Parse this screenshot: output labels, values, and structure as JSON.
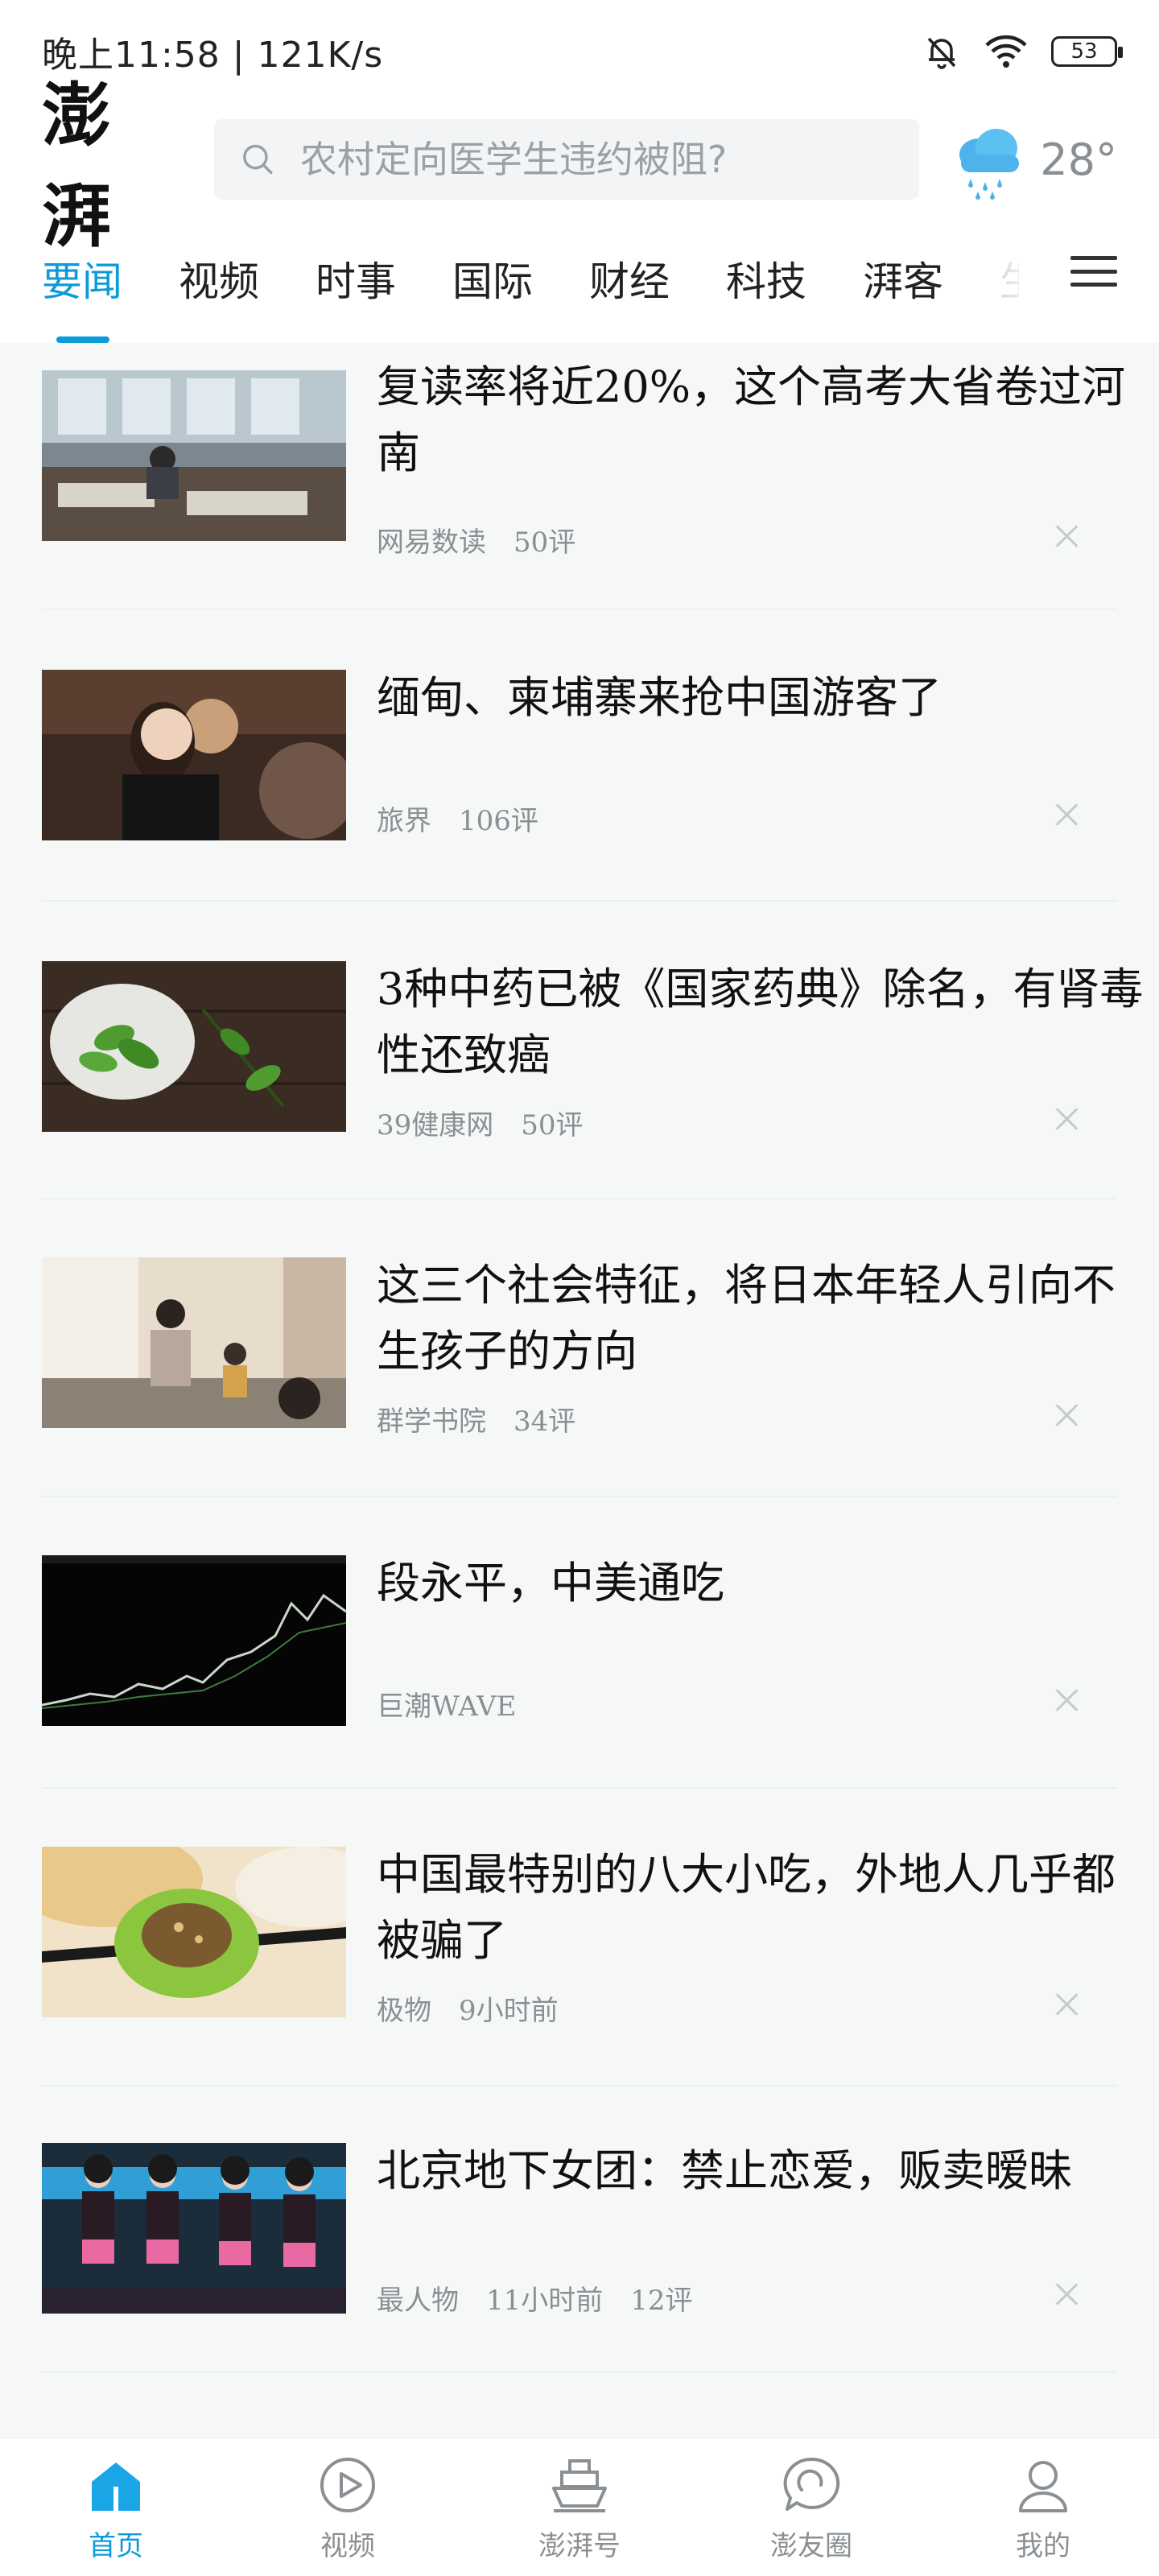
{
  "status_bar": {
    "time_speed": "晚上11:58 | 121K/s",
    "battery": "53"
  },
  "header": {
    "logo": "澎湃",
    "search_placeholder": "农村定向医学生违约被阻?",
    "weather_temp": "28°",
    "weather_icon": "rain-cloud-icon"
  },
  "tabs": [
    {
      "label": "要闻",
      "active": true
    },
    {
      "label": "视频"
    },
    {
      "label": "时事"
    },
    {
      "label": "国际"
    },
    {
      "label": "财经"
    },
    {
      "label": "科技"
    },
    {
      "label": "湃客"
    },
    {
      "label": "生"
    }
  ],
  "feed": [
    {
      "title": "复读率将近20%，这个高考大省卷过河南",
      "meta": [
        "网易数读",
        "50评"
      ],
      "image": "classroom-photo"
    },
    {
      "title": "缅甸、柬埔寨来抢中国游客了",
      "meta": [
        "旅界",
        "106评"
      ],
      "image": "women-photo"
    },
    {
      "title": "3种中药已被《国家药典》除名，有肾毒性还致癌",
      "meta": [
        "39健康网",
        "50评"
      ],
      "image": "herb-leaves-photo"
    },
    {
      "title": "这三个社会特征，将日本年轻人引向不生孩子的方向",
      "meta": [
        "群学书院",
        "34评"
      ],
      "image": "family-photo"
    },
    {
      "title": "段永平，中美通吃",
      "meta": [
        "巨潮WAVE"
      ],
      "image": "stock-chart-photo"
    },
    {
      "title": "中国最特别的八大小吃，外地人几乎都被骗了",
      "meta": [
        "极物",
        "9小时前"
      ],
      "image": "dumpling-photo"
    },
    {
      "title": "北京地下女团：禁止恋爱，贩卖暧昧",
      "meta": [
        "最人物",
        "11小时前",
        "12评"
      ],
      "image": "girl-group-photo"
    }
  ],
  "bottom_nav": [
    {
      "label": "首页",
      "icon": "home-icon",
      "active": true
    },
    {
      "label": "视频",
      "icon": "play-icon"
    },
    {
      "label": "澎湃号",
      "icon": "ship-icon"
    },
    {
      "label": "澎友圈",
      "icon": "chat-bubble-icon"
    },
    {
      "label": "我的",
      "icon": "person-icon"
    }
  ],
  "colors": {
    "accent": "#0a9bd9",
    "feed_bg": "#f6f8f8",
    "meta_text": "#8a8f93"
  }
}
